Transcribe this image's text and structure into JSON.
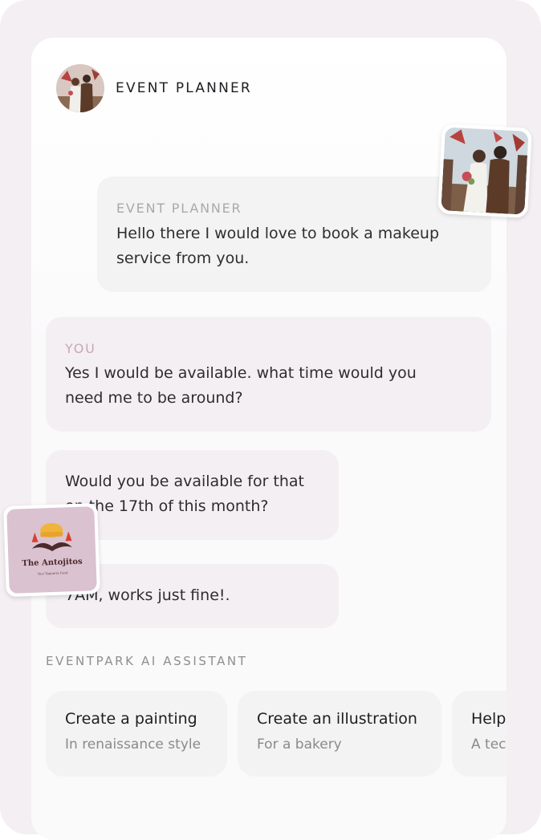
{
  "header": {
    "title": "EVENT PLANNER"
  },
  "messages": [
    {
      "sender": "EVENT PLANNER",
      "lines": [
        "Hello there I would love to book a makeup",
        "service from you."
      ]
    },
    {
      "sender": "YOU",
      "lines": [
        "Yes I would be available. what time would you",
        "need me to be around?"
      ]
    },
    {
      "lines": [
        "Would you be available for that",
        "on the 17th of this month?"
      ]
    },
    {
      "lines": [
        "7AM, works just fine!."
      ]
    }
  ],
  "assistant": {
    "label": "EVENTPARK AI ASSISTANT",
    "suggestions": [
      {
        "title": "Create a painting",
        "subtitle": "In renaissance style"
      },
      {
        "title": "Create an illustration",
        "subtitle": "For a bakery"
      },
      {
        "title": "Help",
        "subtitle": "A tec"
      }
    ]
  },
  "logo": {
    "brand": "The Antojitos",
    "tagline": "Your Taqueria Food"
  },
  "colors": {
    "you_label": "#c9a7b5",
    "planner_label": "#a9a9a9",
    "frame": "#f4eff2"
  },
  "icons": {
    "avatar": "couple-photo-avatar",
    "floating_photo": "wedding-photo",
    "floating_logo": "antojitos-logo"
  }
}
